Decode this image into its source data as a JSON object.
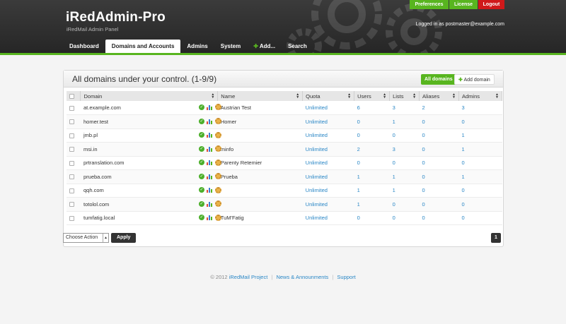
{
  "app": {
    "title": "iRedAdmin-Pro",
    "tagline": "iRedMail Admin Panel",
    "logged_in_text": "Logged in as postmaster@example.com"
  },
  "topbar": {
    "preferences": "Preferences",
    "license": "License",
    "logout": "Logout"
  },
  "nav": {
    "items": [
      "Dashboard",
      "Domains and Accounts",
      "Admins",
      "System",
      "Add...",
      "Search"
    ],
    "active": "Domains and Accounts"
  },
  "panel": {
    "title": "All domains under your control. (1-9/9)",
    "all_domains": "All domains",
    "add_domain": "Add domain"
  },
  "table": {
    "columns": [
      "Domain",
      "Name",
      "Quota",
      "Users",
      "Lists",
      "Aliases",
      "Admins"
    ],
    "rows": [
      {
        "domain": "at.example.com",
        "name": "Austrian Test",
        "quota": "Unlimited",
        "users": "6",
        "lists": "3",
        "aliases": "2",
        "admins": "3"
      },
      {
        "domain": "homer.test",
        "name": "Homer",
        "quota": "Unlimited",
        "users": "0",
        "lists": "1",
        "aliases": "0",
        "admins": "0"
      },
      {
        "domain": "jmb.pl",
        "name": "",
        "quota": "Unlimited",
        "users": "0",
        "lists": "0",
        "aliases": "0",
        "admins": "1"
      },
      {
        "domain": "msi.in",
        "name": "minfo",
        "quota": "Unlimited",
        "users": "2",
        "lists": "3",
        "aliases": "0",
        "admins": "1"
      },
      {
        "domain": "prtranslation.com",
        "name": "Parenty Retemier",
        "quota": "Unlimited",
        "users": "0",
        "lists": "0",
        "aliases": "0",
        "admins": "0"
      },
      {
        "domain": "prueba.com",
        "name": "Prueba",
        "quota": "Unlimited",
        "users": "1",
        "lists": "1",
        "aliases": "0",
        "admins": "1"
      },
      {
        "domain": "qqh.com",
        "name": "",
        "quota": "Unlimited",
        "users": "1",
        "lists": "1",
        "aliases": "0",
        "admins": "0"
      },
      {
        "domain": "totolol.com",
        "name": "",
        "quota": "Unlimited",
        "users": "1",
        "lists": "0",
        "aliases": "0",
        "admins": "0"
      },
      {
        "domain": "tumfatig.local",
        "name": "TuM'Fatig",
        "quota": "Unlimited",
        "users": "0",
        "lists": "0",
        "aliases": "0",
        "admins": "0"
      }
    ]
  },
  "actions": {
    "select_value": "Choose Action",
    "apply": "Apply",
    "page": "1"
  },
  "footer": {
    "copyright": "© 2012",
    "project": "iRedMail Project",
    "news": "News & Announments",
    "support": "Support"
  },
  "colors": {
    "accent_green": "#58b51f",
    "logout_red": "#d0191a",
    "link_blue": "#2a87c6"
  },
  "icons": [
    "enabled-check-icon",
    "statistics-chart-icon",
    "settings-gear-icon"
  ]
}
